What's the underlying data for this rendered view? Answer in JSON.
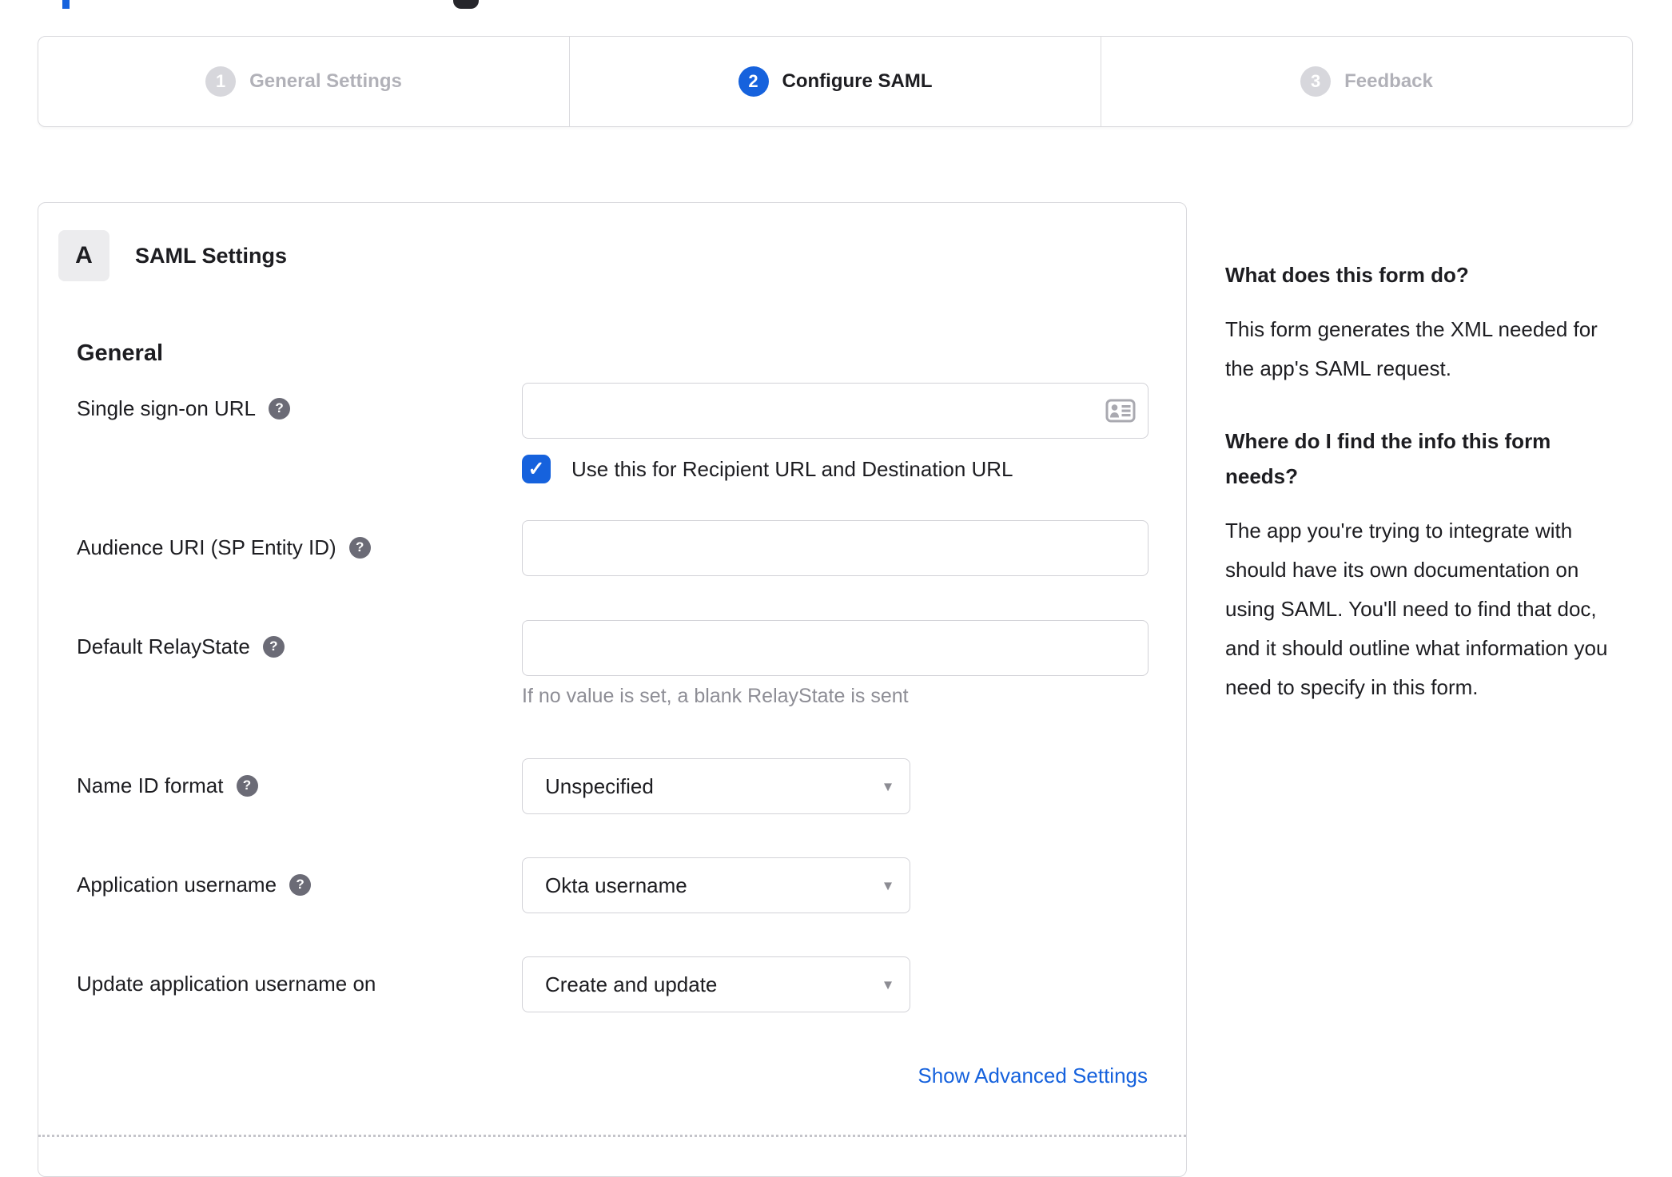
{
  "stepper": {
    "steps": [
      {
        "number": "1",
        "label": "General Settings",
        "active": false
      },
      {
        "number": "2",
        "label": "Configure SAML",
        "active": true
      },
      {
        "number": "3",
        "label": "Feedback",
        "active": false
      }
    ]
  },
  "panel": {
    "section_letter": "A",
    "section_title": "SAML Settings",
    "group_heading": "General",
    "advanced_link": "Show Advanced Settings"
  },
  "form": {
    "sso": {
      "label": "Single sign-on URL",
      "value": "",
      "checkbox_label": "Use this for Recipient URL and Destination URL",
      "checkbox_checked": true
    },
    "audience": {
      "label": "Audience URI (SP Entity ID)",
      "value": ""
    },
    "relay": {
      "label": "Default RelayState",
      "value": "",
      "helper": "If no value is set, a blank RelayState is sent"
    },
    "nameid": {
      "label": "Name ID format",
      "value": "Unspecified"
    },
    "appuser": {
      "label": "Application username",
      "value": "Okta username"
    },
    "updateuser": {
      "label": "Update application username on",
      "value": "Create and update"
    }
  },
  "help_panel": {
    "q1": "What does this form do?",
    "a1": "This form generates the XML needed for the app's SAML request.",
    "q2": "Where do I find the info this form needs?",
    "a2": "The app you're trying to integrate with should have its own documentation on using SAML. You'll need to find that doc, and it should outline what information you need to specify in this form."
  },
  "icons": {
    "help_glyph": "?",
    "caret_glyph": "▾",
    "check_glyph": "✓"
  },
  "colors": {
    "accent": "#1662dd",
    "inactive_step": "#d7d7dc",
    "inactive_text": "#b1b1b8",
    "border": "#d8d8dc",
    "text": "#1d1d21",
    "muted": "#8d8d95",
    "icon_gray": "#a9a9b0"
  }
}
